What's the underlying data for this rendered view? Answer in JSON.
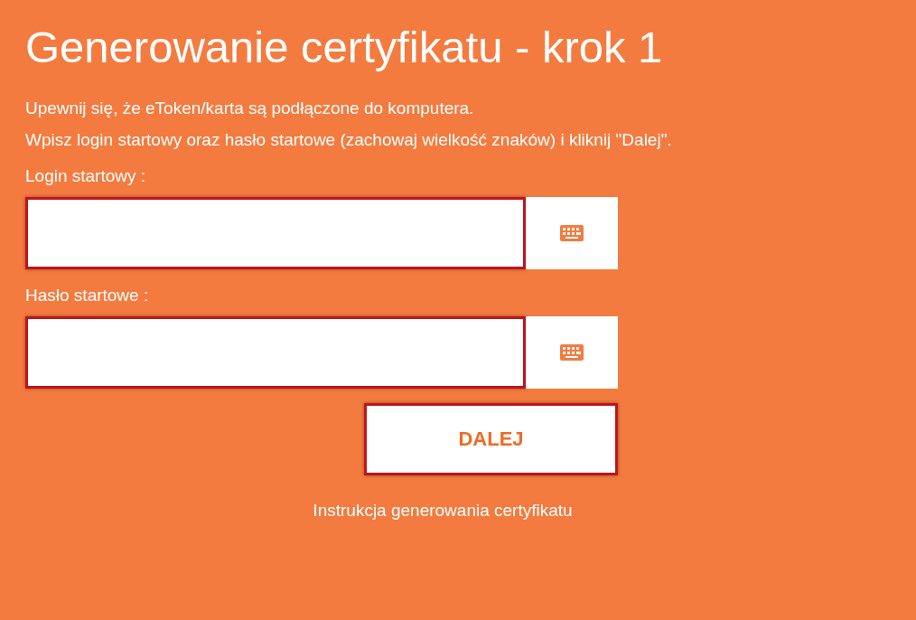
{
  "title": "Generowanie certyfikatu - krok 1",
  "instructions": [
    "Upewnij się, że eToken/karta są podłączone do komputera.",
    "Wpisz login startowy oraz hasło startowe (zachowaj wielkość znaków) i kliknij \"Dalej\"."
  ],
  "fields": [
    {
      "label": "Login startowy :",
      "highlighted": true
    },
    {
      "label": "Hasło startowe :",
      "highlighted": true
    }
  ],
  "submit": {
    "label": "DALEJ",
    "highlighted": true
  },
  "help_link": "Instrukcja generowania certyfikatu"
}
